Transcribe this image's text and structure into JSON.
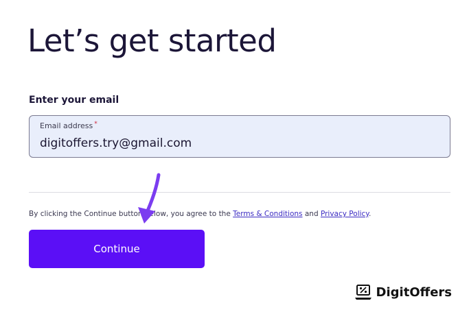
{
  "page": {
    "title": "Let’s get started",
    "email_section_label": "Enter your email"
  },
  "email_field": {
    "label": "Email address",
    "required_marker": "*",
    "value": "digitoffers.try@gmail.com"
  },
  "terms": {
    "text_before": "By clicking the Continue button below, you agree to the ",
    "terms_link": "Terms & Conditions",
    "text_middle": " and ",
    "privacy_link": "Privacy Policy",
    "text_after": "."
  },
  "continue_button": {
    "label": "Continue"
  },
  "watermark": {
    "brand": "DigitOffers",
    "icon": "percent-laptop-icon"
  },
  "annotation": {
    "icon": "arrow-pointer-icon"
  },
  "colors": {
    "accent": "#5b0ff6",
    "field_bg": "#e9eefb",
    "title": "#1c1638",
    "link": "#3b2bc2",
    "required": "#d0263b",
    "annotation_arrow": "#7b3df0"
  }
}
